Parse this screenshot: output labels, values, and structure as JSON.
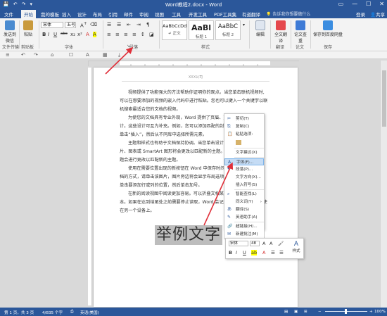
{
  "window": {
    "title": "Word教程2.docx - Word",
    "quick_access": [
      "💾",
      "↶",
      "↷",
      "▾"
    ],
    "controls": [
      "▭",
      "—",
      "☐",
      "✕"
    ]
  },
  "tabs": [
    "文件",
    "开始",
    "我的模板",
    "插入",
    "设计",
    "布局",
    "引用",
    "邮件",
    "审阅",
    "视图",
    "工具",
    "开发工具",
    "PDF工具集",
    "有道翻译"
  ],
  "search_placeholder": "告诉我你想要做什么",
  "login_label": "登录",
  "share_label": "共享",
  "ribbon": {
    "send_label": "发送到微信",
    "paste_label": "粘贴",
    "font_name": "宋体",
    "font_size": "五号",
    "font_tools": [
      "B",
      "I",
      "U",
      "abc",
      "x₂",
      "x²",
      "A",
      "A"
    ],
    "para_tools": [
      "☰",
      "☰",
      "⇤",
      "⇥",
      "¶"
    ],
    "styles": [
      {
        "preview": "AaBbCcDd",
        "name": "↵ 正文"
      },
      {
        "preview": "AaBl",
        "name": "标题 1"
      },
      {
        "preview": "AaBbC",
        "name": "标题 2"
      }
    ],
    "edit_label": "编辑",
    "fulltext_label": "全文翻译",
    "doc_check_label": "论文查重",
    "paper_label": "论文",
    "save_label": "保存到百度网盘",
    "groups": {
      "file_transfer": "文件传输",
      "clipboard": "剪贴板",
      "font": "字体",
      "paragraph": "段落",
      "styles": "样式",
      "translate": "翻译",
      "paper": "论文",
      "save": "保存"
    }
  },
  "toolbar2": [
    "≡",
    "↶",
    "↷",
    "⌂",
    "☐",
    "A",
    "▦",
    "⤓"
  ],
  "document": {
    "header": "XXX公司",
    "lines": [
      "视频提供了功能强大的方法帮助你证明你的观点。当您单击联机视频时,",
      "可以在想要添加的视频的嵌入代码中进行粘贴。您也可以键入一个关键字以联",
      "机搜索最适合您的文档的视频。",
      "为使您的文档具有专业外观，Word 提供了页眉、页脚、封面和",
      "计。这些设计可互为补充。例如，您可以添加匹配的封面、页眉和",
      "单击“插入”，然后从不同库中选择所需元素。",
      "主题和样式也有助于文档保持协调。当您单击设计并选择新的主",
      "片、图表或 SmartArt 图形将会更改以匹配新的主题。当应用样式",
      "题会进行更改以匹配新的主题。",
      "使用在需要位置出现的新按钮在 Word 中保存时间。若要更改",
      "档的方式，请单击该图片，图片旁边将会显示布局选项按钮。当处",
      "单击要添加行或列的位置，然后单击加号。",
      "在新的阅读视图中阅读更加容易。可以折叠文档某些部分并关注",
      "本。如果在达到结尾处之前需要停止读取，Word 会记住您的停止位置 - 即使",
      "在另一个设备上。"
    ],
    "big_text": "举例文字"
  },
  "context_menu": [
    {
      "icon": "✂",
      "label": "剪切(T)"
    },
    {
      "icon": "⎘",
      "label": "复制(C)"
    },
    {
      "icon": "📋",
      "label": "粘贴选项:"
    },
    {
      "icon": "",
      "label": "文字建议(X)"
    },
    {
      "icon": "A",
      "label": "字体(F)..."
    },
    {
      "icon": "¶",
      "label": "段落(P)..."
    },
    {
      "icon": "",
      "label": "文字方向(X)..."
    },
    {
      "icon": "",
      "label": "插入符号(S)"
    },
    {
      "icon": "",
      "label": "智能查找(L)"
    },
    {
      "icon": "",
      "label": "同义词(Y)"
    },
    {
      "icon": "",
      "label": "翻译(S)"
    },
    {
      "icon": "",
      "label": "英语助手(A)"
    },
    {
      "icon": "🔗",
      "label": "超链接(H)..."
    },
    {
      "icon": "",
      "label": "新建批注(M)"
    }
  ],
  "mini_toolbar": {
    "font": "宋体",
    "size": "48",
    "style_label": "样式"
  },
  "status": {
    "page": "第 1 页，共 3 页",
    "words": "4/835 个字",
    "proof": "⎙",
    "language": "英语(美国)",
    "zoom": "100%"
  },
  "colors": {
    "brand": "#2b579a",
    "highlight": "#c5dcf5",
    "arrow": "#e0303a"
  }
}
